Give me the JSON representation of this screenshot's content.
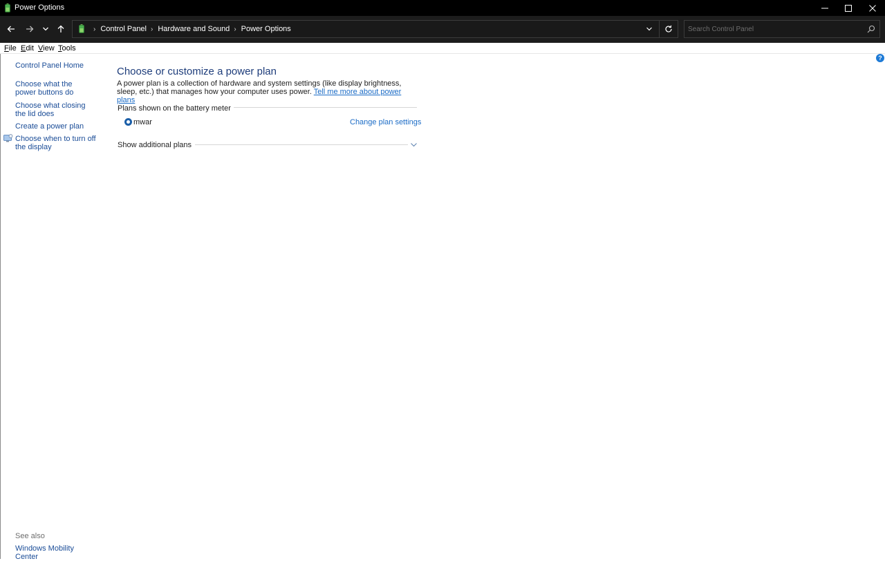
{
  "window": {
    "title": "Power Options",
    "minimize_icon": "minimize-icon",
    "maximize_icon": "maximize-icon",
    "close_icon": "close-icon"
  },
  "address_bar": {
    "breadcrumbs": [
      "Control Panel",
      "Hardware and Sound",
      "Power Options"
    ],
    "search_placeholder": "Search Control Panel"
  },
  "menu": {
    "items": [
      {
        "accel": "F",
        "rest": "ile"
      },
      {
        "accel": "E",
        "rest": "dit"
      },
      {
        "accel": "V",
        "rest": "iew"
      },
      {
        "accel": "T",
        "rest": "ools"
      }
    ]
  },
  "left_pane": {
    "home": "Control Panel Home",
    "links": [
      "Choose what the power buttons do",
      "Choose what closing the lid does",
      "Create a power plan",
      "Choose when to turn off the display"
    ],
    "see_also_label": "See also",
    "see_also_links": [
      "Windows Mobility Center"
    ]
  },
  "main": {
    "heading": "Choose or customize a power plan",
    "description": "A power plan is a collection of hardware and system settings (like display brightness, sleep, etc.) that manages how your computer uses power.",
    "description_link": "Tell me more about power plans",
    "plans_group_label": "Plans shown on the battery meter",
    "plans": [
      {
        "name": "mwar",
        "selected": true,
        "action": "Change plan settings"
      }
    ],
    "additional_plans_label": "Show additional plans"
  },
  "help": {
    "label": "?"
  },
  "colors": {
    "titlebar": "#000000",
    "navbar": "#1c1c1c",
    "link": "#1a4c97",
    "heading": "#1d3c7a",
    "accent": "#1d7ad6"
  }
}
